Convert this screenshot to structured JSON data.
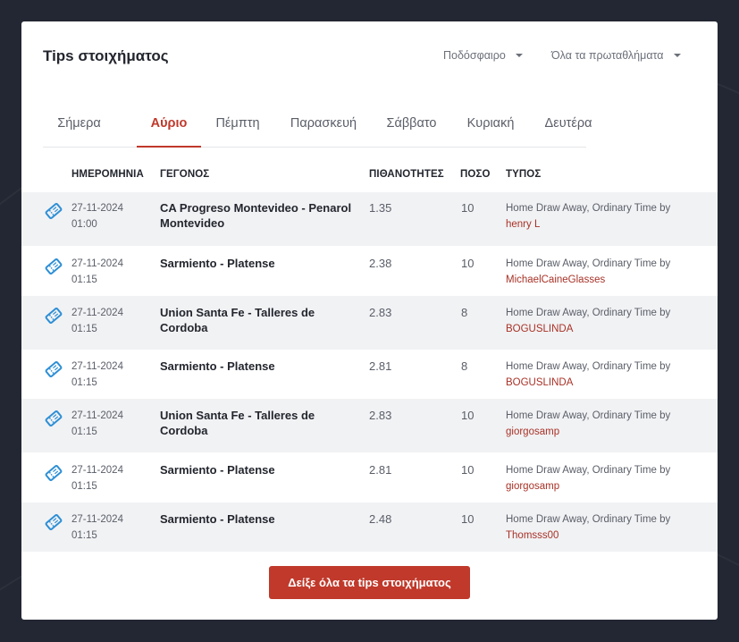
{
  "header": {
    "title": "Tips στοιχήματος",
    "sport_filter": "Ποδόσφαιρο",
    "league_filter": "Όλα τα πρωταθλήματα"
  },
  "tabs": [
    {
      "label": "Σήμερα",
      "active": false
    },
    {
      "label": "Αύριο",
      "active": true
    },
    {
      "label": "Πέμπτη",
      "active": false
    },
    {
      "label": "Παρασκευή",
      "active": false
    },
    {
      "label": "Σάββατο",
      "active": false
    },
    {
      "label": "Κυριακή",
      "active": false
    },
    {
      "label": "Δευτέρα",
      "active": false
    }
  ],
  "table": {
    "headers": {
      "date": "ΗΜΕΡΟΜΗΝΙΑ",
      "event": "ΓΕΓΟΝΟΣ",
      "odds": "ΠΙΘΑΝΟΤΗΤΕΣ",
      "stake": "ΠΟΣΟ",
      "type": "ΤΥΠΟΣ"
    },
    "rows": [
      {
        "date": "27-11-2024",
        "time": "01:00",
        "event": "CA Progreso Montevideo - Penarol Montevideo",
        "odds": "1.35",
        "stake": "10",
        "type": "Home Draw Away, Ordinary Time by",
        "user": "henry L"
      },
      {
        "date": "27-11-2024",
        "time": "01:15",
        "event": "Sarmiento - Platense",
        "odds": "2.38",
        "stake": "10",
        "type": "Home Draw Away, Ordinary Time by",
        "user": "MichaelCaineGlasses"
      },
      {
        "date": "27-11-2024",
        "time": "01:15",
        "event": "Union Santa Fe - Talleres de Cordoba",
        "odds": "2.83",
        "stake": "8",
        "type": "Home Draw Away, Ordinary Time by",
        "user": "BOGUSLINDA"
      },
      {
        "date": "27-11-2024",
        "time": "01:15",
        "event": "Sarmiento - Platense",
        "odds": "2.81",
        "stake": "8",
        "type": "Home Draw Away, Ordinary Time by",
        "user": "BOGUSLINDA"
      },
      {
        "date": "27-11-2024",
        "time": "01:15",
        "event": "Union Santa Fe - Talleres de Cordoba",
        "odds": "2.83",
        "stake": "10",
        "type": "Home Draw Away, Ordinary Time by",
        "user": "giorgosamp"
      },
      {
        "date": "27-11-2024",
        "time": "01:15",
        "event": "Sarmiento - Platense",
        "odds": "2.81",
        "stake": "10",
        "type": "Home Draw Away, Ordinary Time by",
        "user": "giorgosamp"
      },
      {
        "date": "27-11-2024",
        "time": "01:15",
        "event": "Sarmiento - Platense",
        "odds": "2.48",
        "stake": "10",
        "type": "Home Draw Away, Ordinary Time by",
        "user": "Thomsss00"
      }
    ]
  },
  "cta": {
    "label": "Δείξε όλα τα tips στοιχήματος"
  },
  "colors": {
    "accent": "#c0392b",
    "ticket_icon": "#2d8fd5",
    "background": "#232733",
    "row_shade": "#f1f2f4"
  },
  "icons": {
    "row_icon": "ticket-icon",
    "dropdown": "caret-down-icon"
  }
}
